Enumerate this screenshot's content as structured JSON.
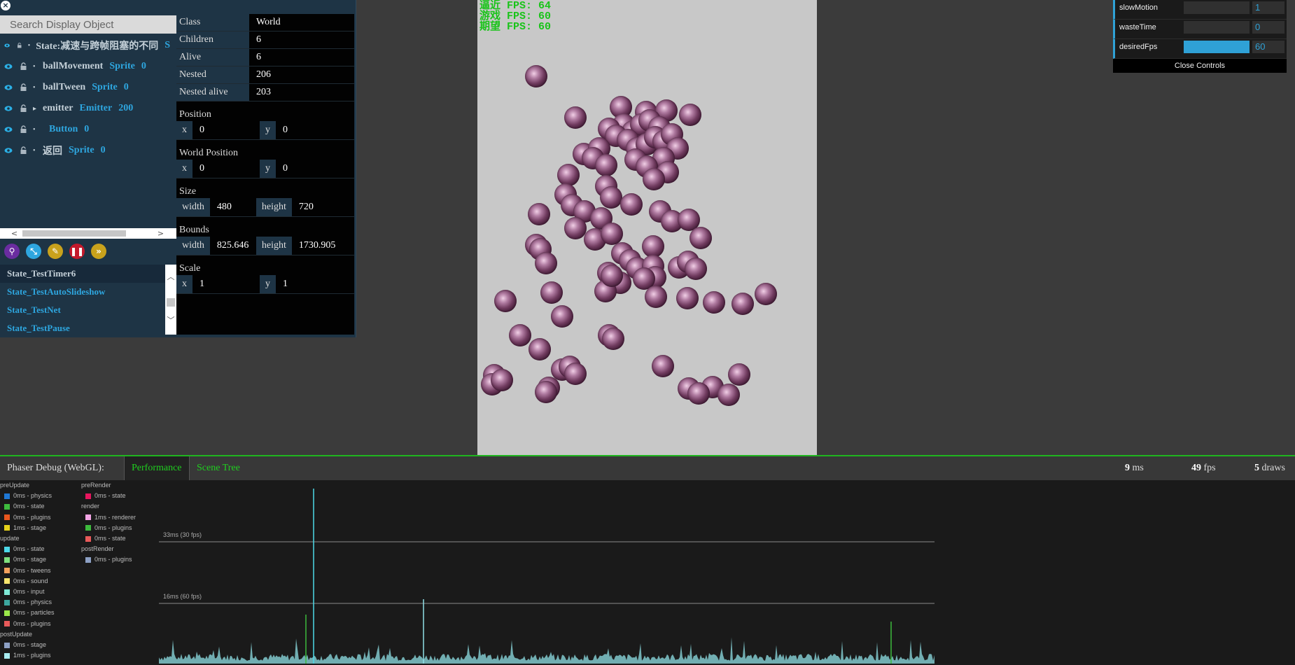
{
  "tree": {
    "search_placeholder": "Search Display Object",
    "rows": [
      {
        "name": "State:减速与跨帧阻塞的不同",
        "type": "S",
        "count": "",
        "has_children": false
      },
      {
        "name": "ballMovement",
        "type": "Sprite",
        "count": "0",
        "has_children": false
      },
      {
        "name": "ballTween",
        "type": "Sprite",
        "count": "0",
        "has_children": false
      },
      {
        "name": "emitter",
        "type": "Emitter",
        "count": "200",
        "has_children": true
      },
      {
        "name": "",
        "type": "Button",
        "count": "0",
        "has_children": false
      },
      {
        "name": "返回",
        "type": "Sprite",
        "count": "0",
        "has_children": false
      }
    ],
    "toolbar": [
      {
        "icon": "search-icon",
        "color": "#6a2ca0"
      },
      {
        "icon": "compress-icon",
        "color": "#2ea6df"
      },
      {
        "icon": "brush-icon",
        "color": "#c9a21c"
      },
      {
        "icon": "pause-icon",
        "color": "#c3192c"
      },
      {
        "icon": "fast-forward-icon",
        "color": "#c9a21c"
      }
    ],
    "states": [
      "State_TestTimer6",
      "State_TestAutoSlideshow",
      "State_TestNet",
      "State_TestPause"
    ],
    "selected_state": 0
  },
  "props": {
    "class_k": "Class",
    "class_v": "World",
    "children_k": "Children",
    "children_v": "6",
    "alive_k": "Alive",
    "alive_v": "6",
    "nested_k": "Nested",
    "nested_v": "206",
    "nested_alive_k": "Nested alive",
    "nested_alive_v": "203",
    "position": {
      "label": "Position",
      "x_k": "x",
      "x": "0",
      "y_k": "y",
      "y": "0"
    },
    "world_position": {
      "label": "World Position",
      "x_k": "x",
      "x": "0",
      "y_k": "y",
      "y": "0"
    },
    "size": {
      "label": "Size",
      "w_k": "width",
      "w": "480",
      "h_k": "height",
      "h": "720"
    },
    "bounds": {
      "label": "Bounds",
      "w_k": "width",
      "w": "825.646",
      "h_k": "height",
      "h": "1730.905"
    },
    "scale": {
      "label": "Scale",
      "x_k": "x",
      "x": "1",
      "y_k": "y",
      "y": "1"
    }
  },
  "game": {
    "fps_lines": [
      "逼近 FPS: 64",
      "游戏 FPS: 60",
      "期望 FPS: 60"
    ]
  },
  "gui": {
    "controls": [
      {
        "label": "slowMotion",
        "value": "1",
        "fill": 0
      },
      {
        "label": "wasteTime",
        "value": "0",
        "fill": 0
      },
      {
        "label": "desiredFps",
        "value": "60",
        "fill": 1
      }
    ],
    "close_label": "Close Controls"
  },
  "debug": {
    "title": "Phaser Debug (WebGL):",
    "tabs": [
      "Performance",
      "Scene Tree"
    ],
    "stat_ms": "9",
    "stat_ms_unit": "ms",
    "stat_fps": "49",
    "stat_fps_unit": "fps",
    "stat_draws": "5",
    "stat_draws_unit": "draws",
    "ref_30": "33ms (30 fps)",
    "ref_60": "16ms (60 fps)",
    "legend_col1": [
      {
        "head": "preUpdate"
      },
      {
        "label": "0ms - physics",
        "color": "#1f77d4"
      },
      {
        "label": "0ms - state",
        "color": "#3dbb3d"
      },
      {
        "label": "0ms - plugins",
        "color": "#e8561e"
      },
      {
        "label": "1ms - stage",
        "color": "#e6d21a"
      },
      {
        "head": "update"
      },
      {
        "label": "0ms - state",
        "color": "#4dd9e8"
      },
      {
        "label": "0ms - stage",
        "color": "#7fe07f"
      },
      {
        "label": "0ms - tweens",
        "color": "#f3a15d"
      },
      {
        "label": "0ms - sound",
        "color": "#f7e56e"
      },
      {
        "label": "0ms - input",
        "color": "#7fe9d6"
      },
      {
        "label": "0ms - physics",
        "color": "#3da7a0"
      },
      {
        "label": "0ms - particles",
        "color": "#9be94a"
      },
      {
        "label": "0ms - plugins",
        "color": "#e85a5a"
      },
      {
        "head": "postUpdate"
      },
      {
        "label": "0ms - stage",
        "color": "#8da0c4"
      },
      {
        "label": "1ms - plugins",
        "color": "#a8ecf0"
      }
    ],
    "legend_col2": [
      {
        "head": "preRender"
      },
      {
        "label": "0ms - state",
        "color": "#e8155e"
      },
      {
        "head": "render"
      },
      {
        "label": "1ms - renderer",
        "color": "#f4a6e6"
      },
      {
        "label": "0ms - plugins",
        "color": "#3dbb3d"
      },
      {
        "label": "0ms - state",
        "color": "#e85a5a"
      },
      {
        "head": "postRender"
      },
      {
        "label": "0ms - plugins",
        "color": "#8da0c4"
      }
    ]
  }
}
